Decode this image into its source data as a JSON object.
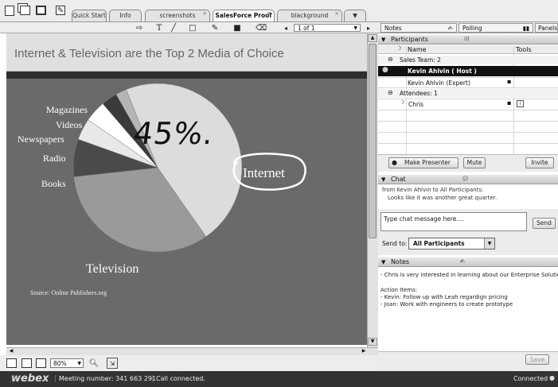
{
  "tabs": [
    {
      "label": "Quick Start"
    },
    {
      "label": "Info"
    },
    {
      "label": "screenshots"
    },
    {
      "label": "SalesForce Proof"
    },
    {
      "label": "blackground"
    }
  ],
  "toolbar": {
    "page_indicator": "1 of 1",
    "zoom": "80%"
  },
  "slide": {
    "title": "Internet & Television are the Top 2 Media of Choice",
    "source": "Source: Online Publishers.org",
    "annotation": "45%.",
    "chart_data": {
      "type": "pie",
      "title": "",
      "categories": [
        "Internet",
        "Television",
        "Books",
        "Radio",
        "Newspapers",
        "Videos",
        "Magazines"
      ],
      "values": [
        45,
        32,
        7,
        4,
        4,
        3,
        2
      ]
    }
  },
  "right_tabs": {
    "notes": "Notes",
    "polling": "Polling",
    "panels": "Panels"
  },
  "participants": {
    "header": "Participants",
    "col_name": "Name",
    "col_tools": "Tools",
    "sales_team": "Sales Team: 2",
    "host": "Kevin Ahlvin ( Host )",
    "expert": "Kevin Ahlvin  (Expert)",
    "attendees": "Attendees: 1",
    "attendee": "Chris",
    "make_presenter": "Make Presenter",
    "mute": "Mute",
    "invite": "Invite"
  },
  "chat": {
    "header": "Chat",
    "from": "from Kevin Ahlvin to All Participants:",
    "message": "Looks like it was another great quarter.",
    "placeholder": "Type chat message here....",
    "send": "Send",
    "send_to_label": "Send to:",
    "send_to_value": "All Participants"
  },
  "notes": {
    "header": "Notes",
    "line1": "- Chris is very interested in learning about our Enterprise Solution.",
    "action_items": "Action Items:",
    "item1": "- Kevin: Follow up with Leah regardign pricing",
    "item2": "- Joan: Work with engineers to create prototype",
    "save": "Save"
  },
  "status": {
    "brand": "webex",
    "meeting": "Meeting number: 341 663 291",
    "call": "Call connected.",
    "connected": "Connected"
  }
}
